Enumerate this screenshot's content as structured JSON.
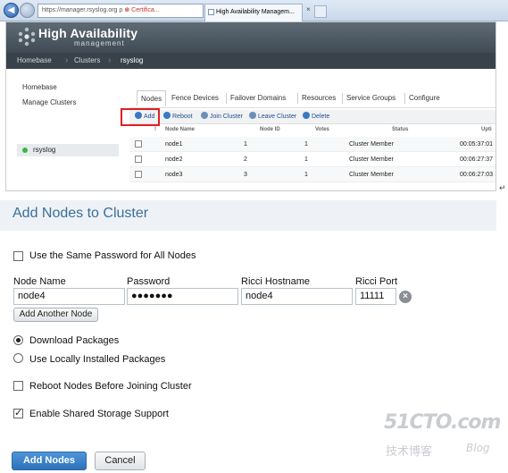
{
  "browser": {
    "address_prefix": "https://",
    "address_host": "manager.rsyslog.org",
    "search_glyph": "ρ",
    "cert_label": "Certifica...",
    "tab_title": "High Availability Managem...",
    "tab_close": "×"
  },
  "ha_app": {
    "title": "High Availability",
    "subtitle": "management",
    "breadcrumbs": [
      "Homebase",
      "Clusters",
      "rsyslog"
    ],
    "sidebar": [
      "Homebase",
      "Manage Clusters"
    ],
    "cluster": "rsyslog",
    "tabs": [
      "Nodes",
      "Fence Devices",
      "Failover Domains",
      "Resources",
      "Service Groups",
      "Configure"
    ],
    "toolbar": [
      "Add",
      "Reboot",
      "Join Cluster",
      "Leave Cluster",
      "Delete"
    ],
    "table_headers": [
      "!",
      "Node Name",
      "Node ID",
      "Votes",
      "Status",
      "Upti"
    ],
    "rows": [
      {
        "name": "node1",
        "id": "1",
        "votes": "1",
        "status": "Cluster Member",
        "uptime": "00:05:37:01"
      },
      {
        "name": "node2",
        "id": "2",
        "votes": "1",
        "status": "Cluster Member",
        "uptime": "00:06:27:37"
      },
      {
        "name": "node3",
        "id": "3",
        "votes": "1",
        "status": "Cluster Member",
        "uptime": "00:06:27:03"
      }
    ]
  },
  "return_mark": "↵",
  "dialog": {
    "title": "Add Nodes to Cluster",
    "same_password_label": "Use the Same Password for All Nodes",
    "columns": [
      "Node Name",
      "Password",
      "Ricci Hostname",
      "Ricci Port"
    ],
    "node_name": "node4",
    "password": "●●●●●●●",
    "ricci_hostname": "node4",
    "ricci_port": "11111",
    "add_another_label": "Add Another Node",
    "download_packages_label": "Download Packages",
    "local_packages_label": "Use Locally Installed Packages",
    "reboot_label": "Reboot Nodes Before Joining Cluster",
    "shared_storage_label": "Enable Shared Storage Support",
    "submit_label": "Add Nodes",
    "cancel_label": "Cancel"
  },
  "watermark": {
    "top": "51CTO.com",
    "bottom": "技术博客",
    "blog": "Blog"
  }
}
